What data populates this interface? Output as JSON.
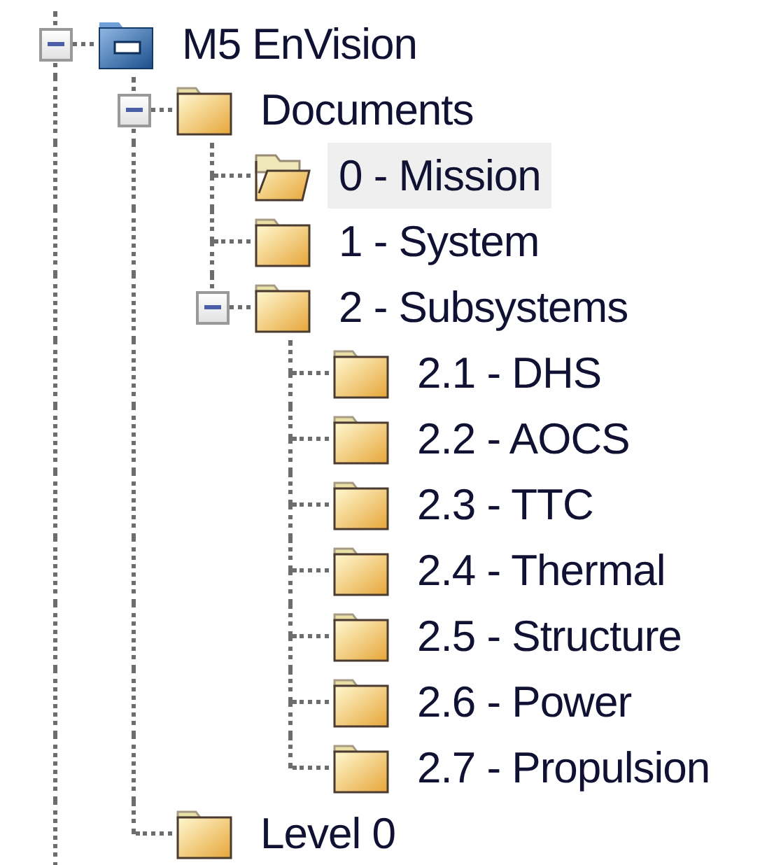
{
  "tree": [
    {
      "label": "M5 EnVision",
      "kind": "project",
      "selected": false,
      "expanded": true,
      "children": [
        {
          "label": "Documents",
          "kind": "folder",
          "selected": false,
          "expanded": true,
          "children": [
            {
              "label": "0 - Mission",
              "kind": "folder",
              "selected": true
            },
            {
              "label": "1 - System",
              "kind": "folder",
              "selected": false
            },
            {
              "label": "2 - Subsystems",
              "kind": "folder",
              "selected": false,
              "expanded": true,
              "children": [
                {
                  "label": "2.1 - DHS",
                  "kind": "folder",
                  "selected": false
                },
                {
                  "label": "2.2 - AOCS",
                  "kind": "folder",
                  "selected": false
                },
                {
                  "label": "2.3 - TTC",
                  "kind": "folder",
                  "selected": false
                },
                {
                  "label": "2.4 - Thermal",
                  "kind": "folder",
                  "selected": false
                },
                {
                  "label": "2.5 - Structure",
                  "kind": "folder",
                  "selected": false
                },
                {
                  "label": "2.6 - Power",
                  "kind": "folder",
                  "selected": false
                },
                {
                  "label": "2.7 - Propulsion",
                  "kind": "folder",
                  "selected": false
                }
              ]
            }
          ]
        },
        {
          "label": "Level 0",
          "kind": "folder",
          "selected": false
        }
      ]
    }
  ]
}
